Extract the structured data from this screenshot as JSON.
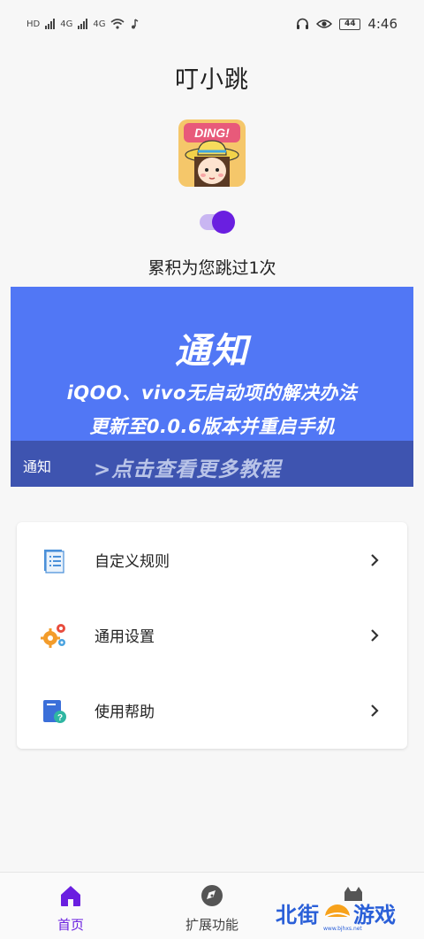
{
  "status_bar": {
    "left_badges": [
      "HD",
      "4G",
      "4G"
    ],
    "battery": "44",
    "time": "4:46"
  },
  "app": {
    "title": "叮小跳",
    "logo_text": "DING!",
    "toggle_on": true,
    "skip_count_text": "累积为您跳过1次"
  },
  "banner": {
    "title": "通知",
    "line1": "iQOO、vivo无启动项的解决办法",
    "line2": "更新至0.0.6版本并重启手机",
    "caption": "通知",
    "more": ">点击查看更多教程"
  },
  "menu": {
    "items": [
      {
        "label": "自定义规则",
        "icon": "document-icon"
      },
      {
        "label": "通用设置",
        "icon": "gears-icon"
      },
      {
        "label": "使用帮助",
        "icon": "help-book-icon"
      }
    ]
  },
  "nav": {
    "home_label": "首页",
    "ext_label": "扩展功能"
  },
  "watermark": {
    "left": "北街",
    "right": "游戏",
    "sub": "www.bjhxs.net"
  },
  "colors": {
    "accent": "#6a1fe0",
    "banner_bg": "#5177f5",
    "banner_footer": "#3e54b0"
  }
}
